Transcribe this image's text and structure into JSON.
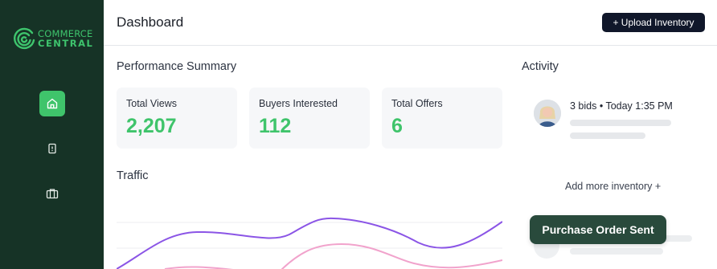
{
  "brand": {
    "line1": "COMMERCE",
    "line2": "CENTRAL",
    "color": "#3ec46d"
  },
  "sidebar": {
    "items": [
      {
        "icon": "home-icon",
        "active": true
      },
      {
        "icon": "document-icon",
        "active": false
      },
      {
        "icon": "briefcase-icon",
        "active": false
      }
    ]
  },
  "header": {
    "title": "Dashboard",
    "upload_label": "+ Upload Inventory"
  },
  "performance": {
    "title": "Performance Summary",
    "cards": [
      {
        "label": "Total Views",
        "value": "2,207"
      },
      {
        "label": "Buyers Interested",
        "value": "112"
      },
      {
        "label": "Total Offers",
        "value": "6"
      }
    ]
  },
  "traffic": {
    "title": "Traffic",
    "series_colors": [
      "#8b55e6",
      "#f1a3cc"
    ]
  },
  "activity": {
    "title": "Activity",
    "items": [
      {
        "text": "3 bids • Today 1:35 PM"
      }
    ],
    "add_more_label": "Add more inventory +"
  },
  "toast": {
    "text": "Purchase Order Sent"
  },
  "colors": {
    "sidebar": "#163326",
    "accent": "#3fc46b",
    "primary_button": "#10172a"
  }
}
